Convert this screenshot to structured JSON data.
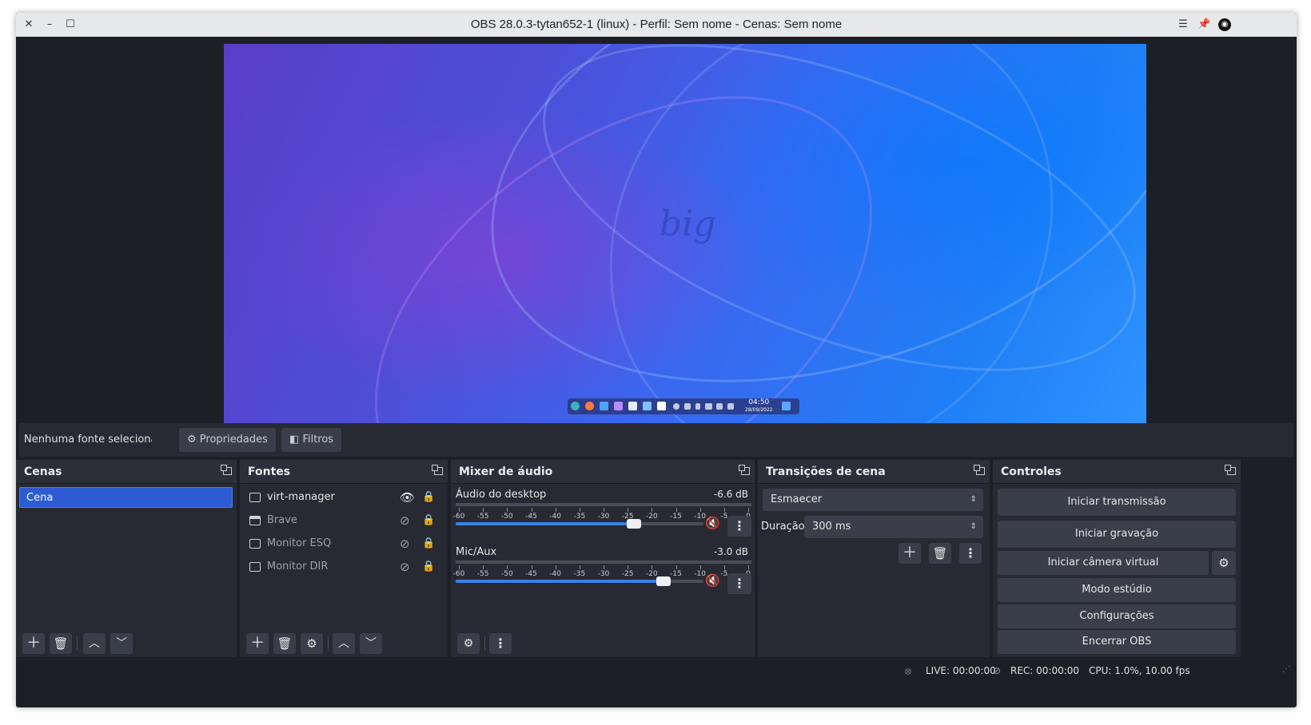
{
  "window": {
    "title": "OBS 28.0.3-tytan652-1 (linux) - Perfil: Sem nome - Cenas: Sem nome",
    "close_glyph": "✕",
    "minimize_glyph": "–",
    "maximize_glyph": "☐"
  },
  "preview": {
    "logo_text": "big",
    "clock_time": "04:50",
    "clock_date": "28/09/2022"
  },
  "source_toolbar": {
    "no_source_text": "Nenhuma fonte selecionada",
    "properties_label": "Propriedades",
    "filters_label": "Filtros"
  },
  "scenes": {
    "title": "Cenas",
    "items": [
      "Cena"
    ]
  },
  "sources": {
    "title": "Fontes",
    "items": [
      {
        "label": "virt-manager",
        "visible": true
      },
      {
        "label": "Brave",
        "visible": false
      },
      {
        "label": "Monitor ESQ",
        "visible": false
      },
      {
        "label": "Monitor DIR",
        "visible": false
      }
    ]
  },
  "mixer": {
    "title": "Mixer de áudio",
    "ticks": [
      "-60",
      "-55",
      "-50",
      "-45",
      "-40",
      "-35",
      "-30",
      "-25",
      "-20",
      "-15",
      "-10",
      "-5",
      "0"
    ],
    "channels": [
      {
        "name": "Áudio do desktop",
        "db": "-6.6 dB",
        "volume": 0.72
      },
      {
        "name": "Mic/Aux",
        "db": "-3.0 dB",
        "volume": 0.84
      }
    ]
  },
  "transitions": {
    "title": "Transições de cena",
    "selected": "Esmaecer",
    "duration_label": "Duração",
    "duration_value": "300 ms"
  },
  "controls": {
    "title": "Controles",
    "start_stream": "Iniciar transmissão",
    "start_record": "Iniciar gravação",
    "start_virtualcam": "Iniciar câmera virtual",
    "studio_mode": "Modo estúdio",
    "settings": "Configurações",
    "exit": "Encerrar OBS"
  },
  "status": {
    "live": "LIVE: 00:00:00",
    "rec": "REC: 00:00:00",
    "cpu": "CPU: 1.0%, 10.00 fps"
  },
  "colors": {
    "accent": "#2d5bd3",
    "mute": "#e0283c"
  }
}
